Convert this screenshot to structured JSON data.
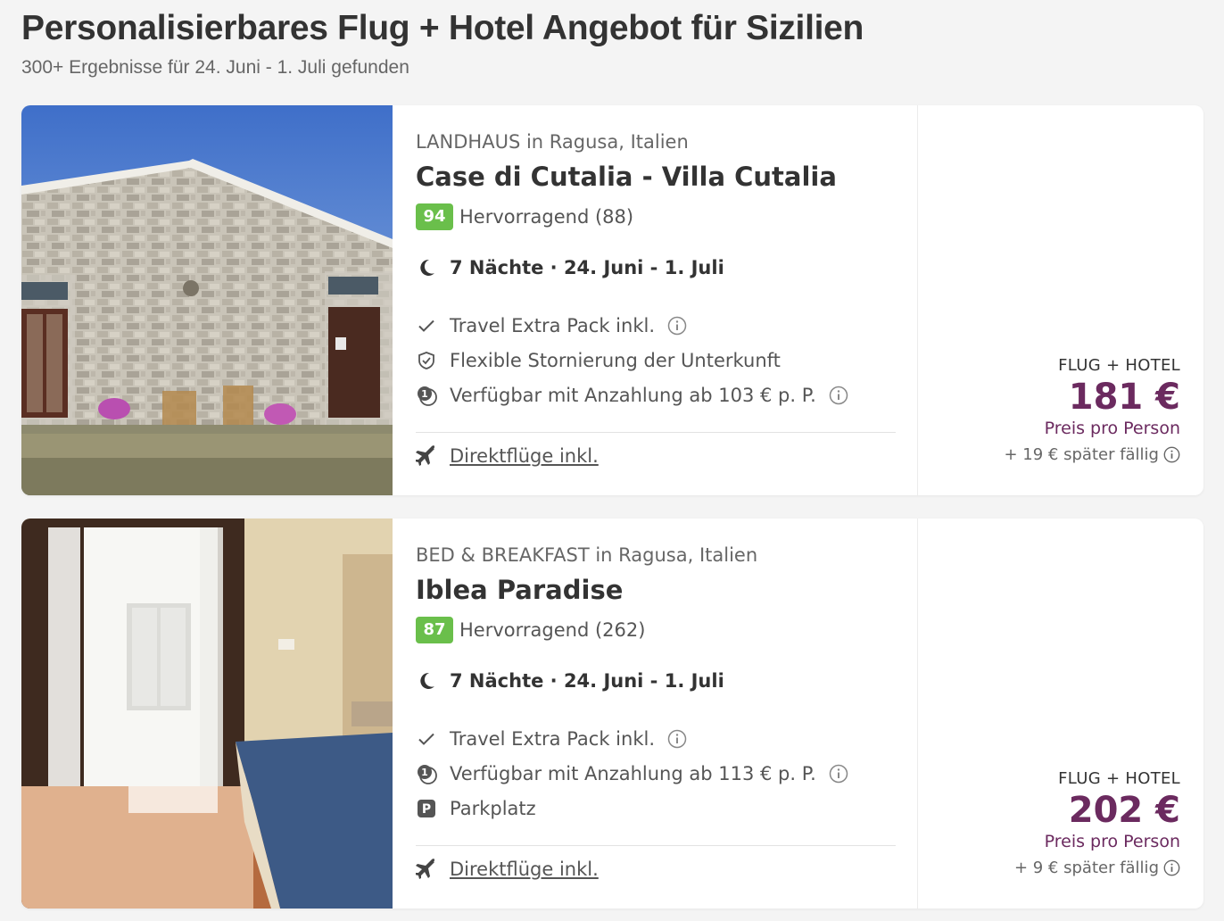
{
  "header": {
    "title": "Personalisierbares Flug + Hotel Angebot für Sizilien",
    "subtitle": "300+ Ergebnisse für 24. Juni - 1. Juli gefunden"
  },
  "colors": {
    "score_badge": "#6abf4b",
    "price": "#6b2a5f"
  },
  "offers": [
    {
      "property_type": "LANDHAUS in Ragusa, Italien",
      "name": "Case di Cutalia - Villa Cutalia",
      "score": "94",
      "rating_text": "Hervorragend (88)",
      "nights": "7 Nächte · 24. Juni - 1. Juli",
      "features": [
        {
          "icon": "check-icon",
          "text": "Travel Extra Pack inkl.",
          "info": true
        },
        {
          "icon": "shield-check-icon",
          "text": "Flexible Stornierung der Unterkunft",
          "info": false
        },
        {
          "icon": "deposit-icon",
          "text": "Verfügbar mit Anzahlung ab 103 € p. P.",
          "info": true
        }
      ],
      "flights": "Direktflüge inkl.",
      "price_label": "FLUG + HOTEL",
      "price": "181 €",
      "price_per": "Preis pro Person",
      "price_later": "+ 19 € später fällig"
    },
    {
      "property_type": "BED & BREAKFAST in Ragusa, Italien",
      "name": "Iblea Paradise",
      "score": "87",
      "rating_text": "Hervorragend (262)",
      "nights": "7 Nächte · 24. Juni - 1. Juli",
      "features": [
        {
          "icon": "check-icon",
          "text": "Travel Extra Pack inkl.",
          "info": true
        },
        {
          "icon": "deposit-icon",
          "text": "Verfügbar mit Anzahlung ab 113 € p. P.",
          "info": true
        },
        {
          "icon": "parking-icon",
          "text": "Parkplatz",
          "info": false
        }
      ],
      "flights": "Direktflüge inkl.",
      "price_label": "FLUG + HOTEL",
      "price": "202 €",
      "price_per": "Preis pro Person",
      "price_later": "+ 9 € später fällig"
    }
  ]
}
